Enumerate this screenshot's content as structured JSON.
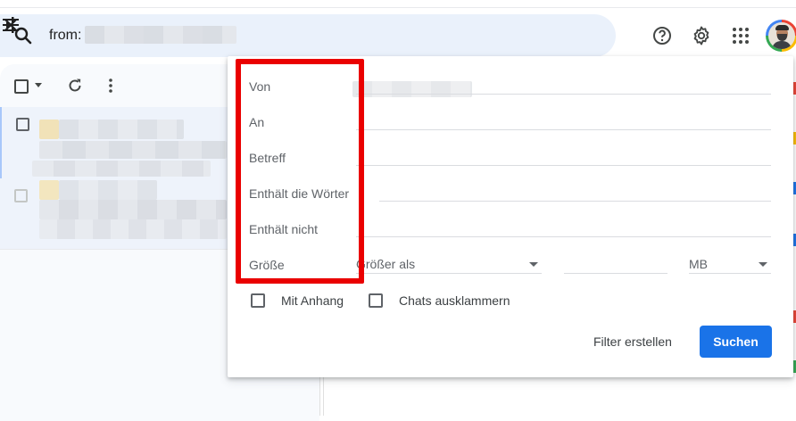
{
  "search": {
    "query": "from:"
  },
  "dialog": {
    "fields": [
      {
        "label": "Von"
      },
      {
        "label": "An"
      },
      {
        "label": "Betreff"
      },
      {
        "label": "Enthält die Wörter"
      },
      {
        "label": "Enthält nicht"
      },
      {
        "label": "Größe"
      }
    ],
    "size_comparison": "Größer als",
    "size_unit": "MB",
    "checkboxes": [
      {
        "label": "Mit Anhang",
        "checked": false
      },
      {
        "label": "Chats ausklammern",
        "checked": false
      }
    ],
    "create_filter_label": "Filter erstellen",
    "search_button_label": "Suchen",
    "highlight_color": "#ea0000"
  },
  "colors": {
    "accent": "#1a73e8",
    "searchbar_bg": "#eaf1fb"
  }
}
